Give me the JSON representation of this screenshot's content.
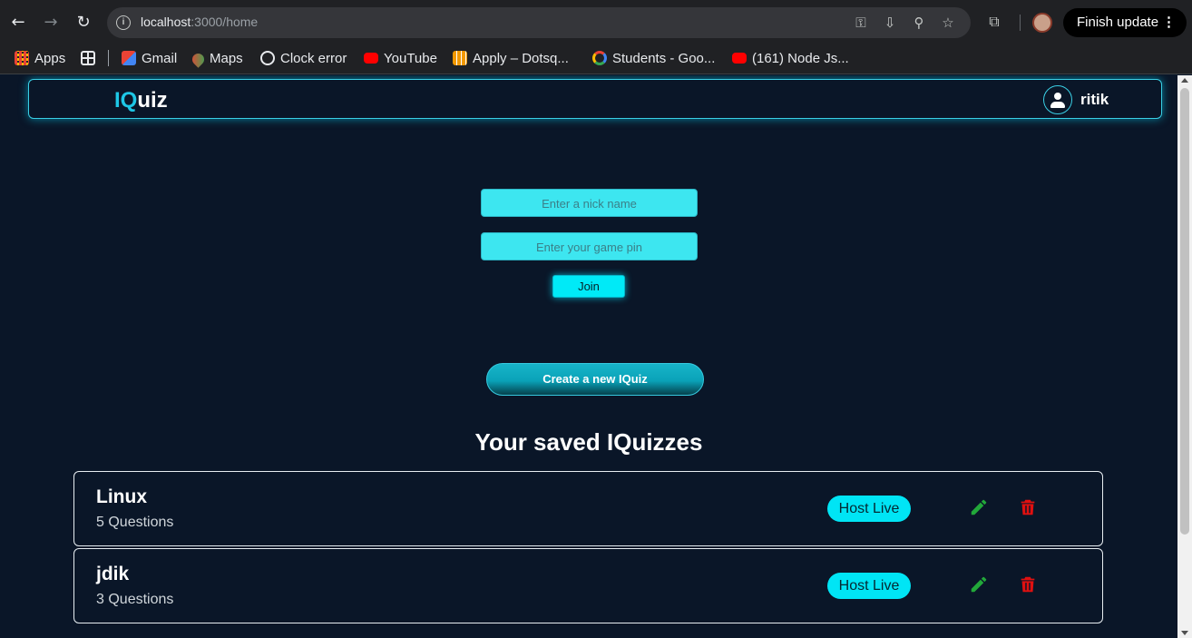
{
  "browser": {
    "url_host": "localhost",
    "url_path": ":3000/home",
    "finish_update_label": "Finish update"
  },
  "bookmarks": [
    {
      "label": "Apps",
      "color": "#ea4335"
    },
    {
      "label": "",
      "color": "#e8eaed"
    },
    {
      "label": "Gmail",
      "color": "#ea4335"
    },
    {
      "label": "Maps",
      "color": "#34a853"
    },
    {
      "label": "Clock error",
      "color": "#e8eaed"
    },
    {
      "label": "YouTube",
      "color": "#ff0000"
    },
    {
      "label": "Apply – Dotsq...",
      "color": "#f29900"
    },
    {
      "label": "Students - Goo...",
      "color": "#4285f4"
    },
    {
      "label": "(161) Node Js...",
      "color": "#ff0000"
    }
  ],
  "app": {
    "logo_accent": "IQ",
    "logo_rest": "uiz",
    "username": "ritik"
  },
  "join_form": {
    "nickname_placeholder": "Enter a nick name",
    "pin_placeholder": "Enter your game pin",
    "join_label": "Join"
  },
  "create_label": "Create a new IQuiz",
  "saved_title": "Your saved IQuizzes",
  "quizzes": [
    {
      "name": "Linux",
      "questions": "5 Questions",
      "host_label": "Host Live"
    },
    {
      "name": "jdik",
      "questions": "3 Questions",
      "host_label": "Host Live"
    }
  ],
  "colors": {
    "accent": "#1ec7e6",
    "edit": "#22b14c",
    "delete": "#e01010",
    "background": "#0a1628"
  }
}
